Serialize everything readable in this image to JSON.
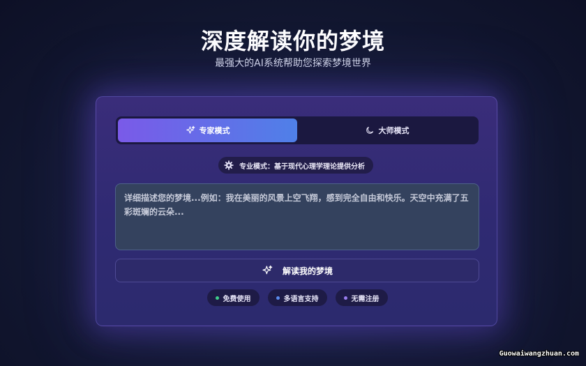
{
  "hero": {
    "title": "深度解读你的梦境",
    "subtitle": "最强大的AI系统帮助您探索梦境世界"
  },
  "mode_switch": {
    "tabs": [
      {
        "label": "专家模式",
        "icon": "sparkle-icon",
        "active": true
      },
      {
        "label": "大师模式",
        "icon": "moon-icon",
        "active": false
      }
    ]
  },
  "mode_description": {
    "icon": "gear-icon",
    "text": "专业模式：基于现代心理学理论提供分析"
  },
  "dream_input": {
    "placeholder": "详细描述您的梦境...例如：我在美丽的风景上空飞翔，感到完全自由和快乐。天空中充满了五彩斑斓的云朵...",
    "value": ""
  },
  "interpret_button": {
    "label": "解读我的梦境",
    "icon": "sparkle-icon"
  },
  "features": [
    {
      "label": "免费使用",
      "dot_color": "#3fd08a"
    },
    {
      "label": "多语言支持",
      "dot_color": "#5b8df0"
    },
    {
      "label": "无需注册",
      "dot_color": "#9a7ef0"
    }
  ],
  "watermark": "Guowaiwangzhuan.com",
  "colors": {
    "accent_start": "#7a5ae8",
    "accent_end": "#4f80e8",
    "panel": "#2f2a72",
    "background": "#141a35"
  }
}
